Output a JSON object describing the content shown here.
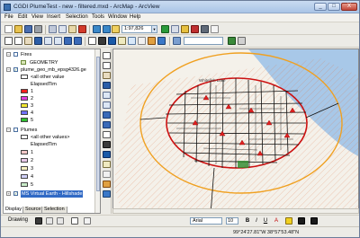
{
  "window": {
    "title": "CGDI PlumeTest - new - filtered.mxd - ArcMap - ArcView",
    "controls": {
      "minimize": "_",
      "maximize": "□",
      "close": "X"
    }
  },
  "menu": {
    "items": [
      "File",
      "Edit",
      "View",
      "Insert",
      "Selection",
      "Tools",
      "Window",
      "Help"
    ]
  },
  "toolbar": {
    "scale": "1:97,826"
  },
  "toc": {
    "rows": [
      {
        "label": "Fires",
        "kind": "group"
      },
      {
        "label": "GEOMETRY",
        "kind": "symbol"
      },
      {
        "label": "plume_geo_mb_epsg4326.ge",
        "kind": "layer"
      },
      {
        "label": "<all other value",
        "kind": "legend"
      },
      {
        "label": "ElapsedTim",
        "kind": "legend"
      },
      {
        "label": "1",
        "kind": "class",
        "color": "#ff2020"
      },
      {
        "label": "2",
        "kind": "class",
        "color": "#e040e0"
      },
      {
        "label": "3",
        "kind": "class",
        "color": "#f2e830"
      },
      {
        "label": "4",
        "kind": "class",
        "color": "#7070ff"
      },
      {
        "label": "5",
        "kind": "class",
        "color": "#30c030"
      },
      {
        "label": "Plumes",
        "kind": "group"
      },
      {
        "label": "<all other values>",
        "kind": "legend"
      },
      {
        "label": "ElapsedTim",
        "kind": "legend"
      },
      {
        "label": "1",
        "kind": "class",
        "color": "#f4c8c8"
      },
      {
        "label": "2",
        "kind": "class",
        "color": "#e8c8e8"
      },
      {
        "label": "3",
        "kind": "class",
        "color": "#f8f0c0"
      },
      {
        "label": "4",
        "kind": "class",
        "color": "#d0d0f8"
      },
      {
        "label": "5",
        "kind": "class",
        "color": "#c8ecc8"
      },
      {
        "label": "MS Virtual Earth - Hillshade",
        "kind": "layer"
      }
    ],
    "tabs": [
      "Display",
      "Source",
      "Selection"
    ],
    "active_tab": "Display"
  },
  "drawing": {
    "label": "Drawing",
    "font": "Arial",
    "font_size": "10",
    "bold": "B",
    "italic": "I",
    "underline": "U",
    "font_color": "A"
  },
  "status": {
    "coordinates": "99°24'27.81\"W  38°57'53.48\"N"
  },
  "map": {
    "place_label": "Whitefish Lake",
    "colors": {
      "circle": "#f0a020",
      "ellipse": "#cc1111",
      "roads": "#111111",
      "hatch": "#e07040",
      "water": "#a8c8e8"
    }
  }
}
